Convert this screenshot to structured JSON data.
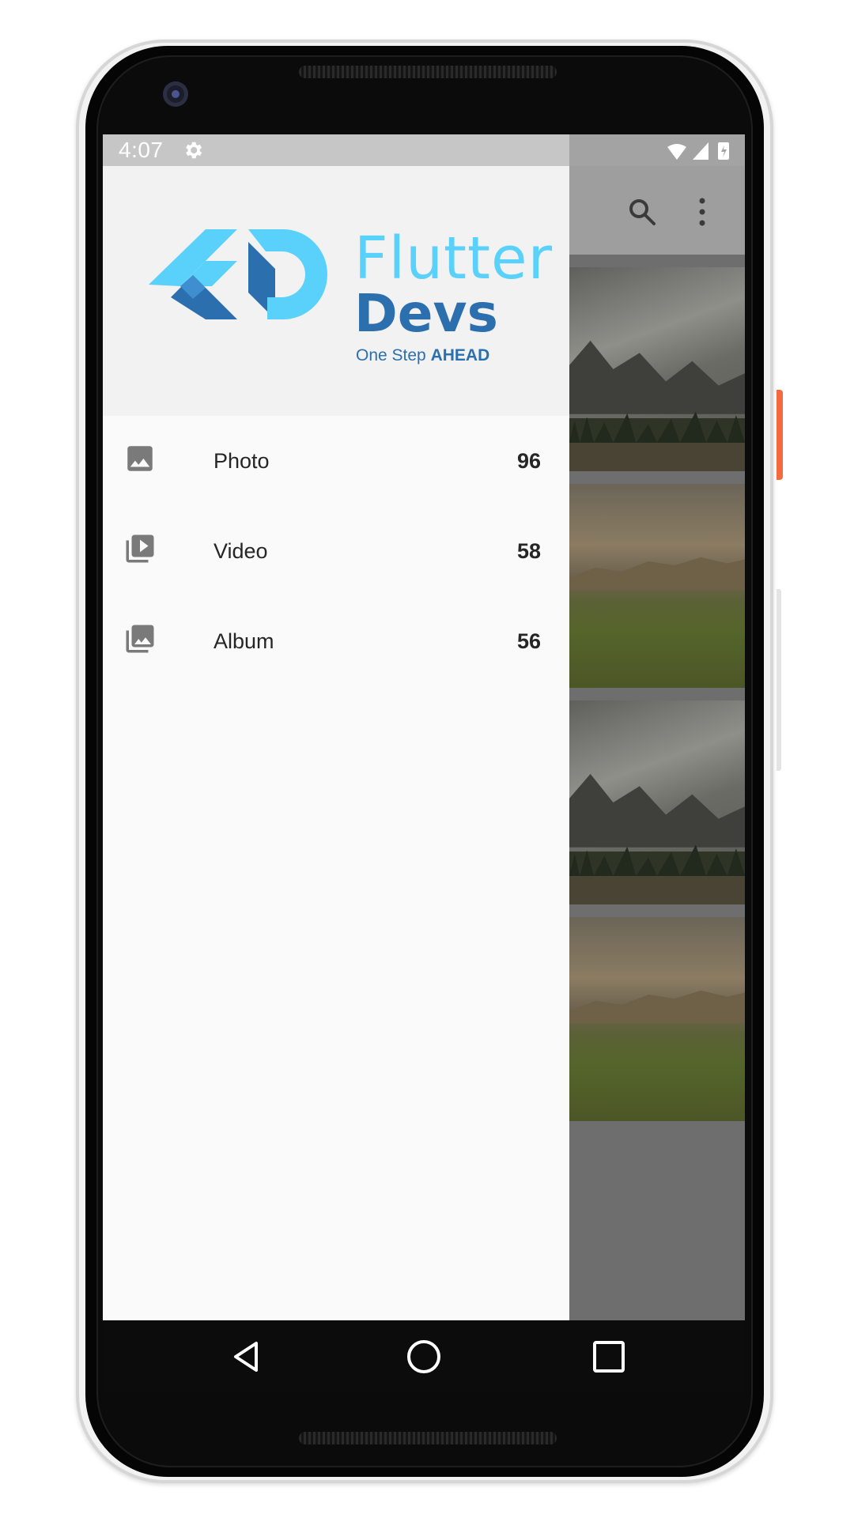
{
  "status_bar": {
    "time": "4:07",
    "icons": [
      "gear-icon",
      "wifi-icon",
      "signal-icon",
      "battery-icon"
    ]
  },
  "app": {
    "toolbar_icons": [
      "search-icon",
      "more-vert-icon"
    ],
    "photos": [
      "mountain",
      "meadow",
      "mountain",
      "meadow"
    ]
  },
  "drawer": {
    "logo": {
      "word1": "Flutter",
      "word2": "Devs",
      "tagline_prefix": "One Step ",
      "tagline_emphasis": "AHEAD",
      "colors": {
        "light": "#5ad1fa",
        "dark": "#2c6fae"
      }
    },
    "items": [
      {
        "label": "Photo",
        "count": "96",
        "icon": "image-icon"
      },
      {
        "label": "Video",
        "count": "58",
        "icon": "video-library-icon"
      },
      {
        "label": "Album",
        "count": "56",
        "icon": "photo-library-icon"
      }
    ]
  },
  "nav_bar": {
    "buttons": [
      "back-icon",
      "home-icon",
      "recents-icon"
    ]
  }
}
